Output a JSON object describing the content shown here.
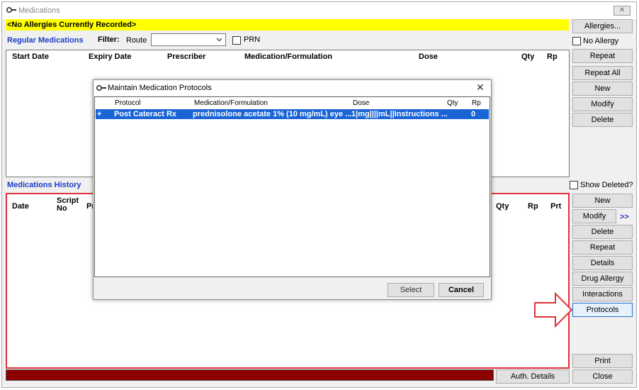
{
  "window": {
    "title": "Medications",
    "close_glyph": "✕"
  },
  "allergy_banner": "<No Allergies Currently Recorded>",
  "regular": {
    "label": "Regular Medications",
    "filter_label": "Filter:",
    "route_label": "Route",
    "route_value": "",
    "prn_label": "PRN",
    "columns": [
      "Start Date",
      "Expiry Date",
      "Prescriber",
      "Medication/Formulation",
      "Dose",
      "Qty",
      "Rp"
    ]
  },
  "history": {
    "label": "Medications History",
    "columns": [
      "Date",
      "Script No",
      "Pr",
      "Qty",
      "Rp",
      "Prt"
    ]
  },
  "right_top": {
    "allergies_btn": "Allergies...",
    "no_allergy_label": "No Allergy",
    "repeat_btn": "Repeat",
    "repeat_all_btn": "Repeat All",
    "new_btn": "New",
    "modify_btn": "Modify",
    "delete_btn": "Delete"
  },
  "right_bottom": {
    "show_deleted_label": "Show Deleted?",
    "new_btn": "New",
    "modify_btn": "Modify",
    "more_btn": ">>",
    "delete_btn": "Delete",
    "repeat_btn": "Repeat",
    "details_btn": "Details",
    "drug_allergy_btn": "Drug Allergy",
    "interactions_btn": "Interactions",
    "protocols_btn": "Protocols",
    "print_btn": "Print",
    "close_btn": "Close"
  },
  "auth_details_btn": "Auth. Details",
  "dialog": {
    "title": "Maintain Medication Protocols",
    "close_glyph": "✕",
    "columns": [
      "Protocol",
      "Medication/Formulation",
      "Dose",
      "Qty",
      "Rp"
    ],
    "rows": [
      {
        "marker": "+",
        "protocol": "Post Cateract Rx",
        "medication": "prednisolone acetate 1% (10 mg/mL) eye ...",
        "dose": "1|mg||||mL||Instructions ...",
        "qty": "",
        "rp": "0"
      }
    ],
    "select_btn": "Select",
    "cancel_btn": "Cancel"
  },
  "colors": {
    "banner": "#ffff00",
    "section_label": "#1a3cc8",
    "highlight": "#1a64d6",
    "annotation_arrow": "#e0333a",
    "status_bar": "#8b0000"
  }
}
